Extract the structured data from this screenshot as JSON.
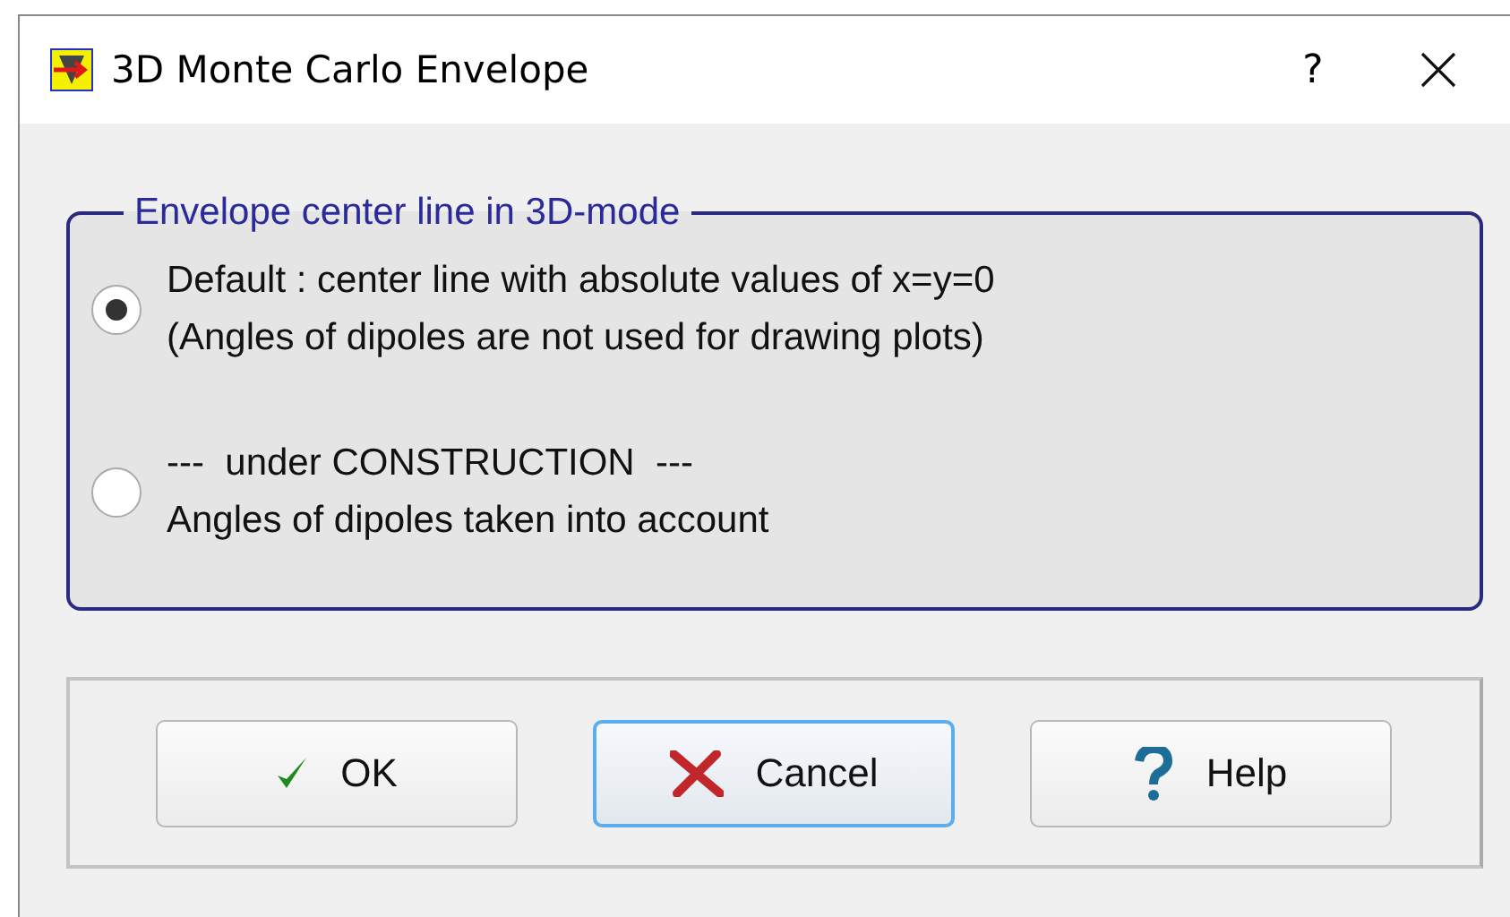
{
  "window": {
    "title": "3D Monte Carlo Envelope",
    "help_button": "?"
  },
  "group": {
    "title": "Envelope center line in 3D-mode",
    "options": [
      {
        "lines": [
          "Default : center line with absolute values of x=y=0",
          "(Angles of dipoles are not used for drawing plots)"
        ],
        "selected": true
      },
      {
        "lines": [
          "---  under CONSTRUCTION  ---",
          "Angles of dipoles taken into account"
        ],
        "selected": false
      }
    ]
  },
  "buttons": [
    {
      "kind": "ok",
      "label": "OK",
      "focused": false
    },
    {
      "kind": "cancel",
      "label": "Cancel",
      "focused": true
    },
    {
      "kind": "help",
      "label": "Help",
      "focused": false
    }
  ]
}
